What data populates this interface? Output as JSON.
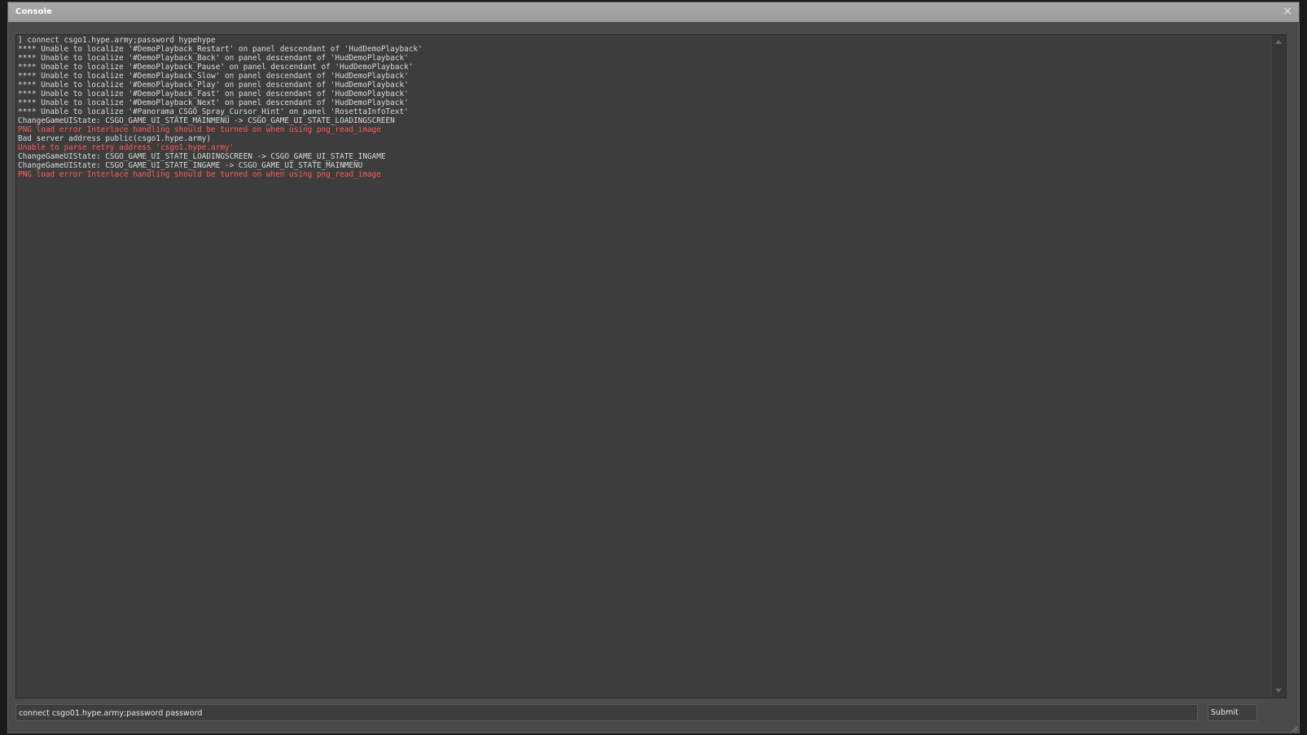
{
  "window": {
    "title": "Console",
    "close_glyph": "✕"
  },
  "console": {
    "lines": [
      {
        "text": "] connect csgo1.hype.army;password hypehype",
        "type": "normal"
      },
      {
        "text": "**** Unable to localize '#DemoPlayback_Restart' on panel descendant of 'HudDemoPlayback'",
        "type": "normal"
      },
      {
        "text": "**** Unable to localize '#DemoPlayback_Back' on panel descendant of 'HudDemoPlayback'",
        "type": "normal"
      },
      {
        "text": "**** Unable to localize '#DemoPlayback_Pause' on panel descendant of 'HudDemoPlayback'",
        "type": "normal"
      },
      {
        "text": "**** Unable to localize '#DemoPlayback_Slow' on panel descendant of 'HudDemoPlayback'",
        "type": "normal"
      },
      {
        "text": "**** Unable to localize '#DemoPlayback_Play' on panel descendant of 'HudDemoPlayback'",
        "type": "normal"
      },
      {
        "text": "**** Unable to localize '#DemoPlayback_Fast' on panel descendant of 'HudDemoPlayback'",
        "type": "normal"
      },
      {
        "text": "**** Unable to localize '#DemoPlayback_Next' on panel descendant of 'HudDemoPlayback'",
        "type": "normal"
      },
      {
        "text": "**** Unable to localize '#Panorama_CSGO_Spray_Cursor_Hint' on panel 'RosettaInfoText'",
        "type": "normal"
      },
      {
        "text": "ChangeGameUIState: CSGO_GAME_UI_STATE_MAINMENU -> CSGO_GAME_UI_STATE_LOADINGSCREEN",
        "type": "normal"
      },
      {
        "text": "PNG load error Interlace handling should be turned on when using png_read_image",
        "type": "error"
      },
      {
        "text": "Bad server address public(csgo1.hype.army)",
        "type": "normal"
      },
      {
        "text": "Unable to parse retry address 'csgo1.hype.army'",
        "type": "error"
      },
      {
        "text": "ChangeGameUIState: CSGO_GAME_UI_STATE_LOADINGSCREEN -> CSGO_GAME_UI_STATE_INGAME",
        "type": "normal"
      },
      {
        "text": "ChangeGameUIState: CSGO_GAME_UI_STATE_INGAME -> CSGO_GAME_UI_STATE_MAINMENU",
        "type": "normal"
      },
      {
        "text": "PNG load error Interlace handling should be turned on when using png_read_image",
        "type": "error"
      }
    ]
  },
  "input": {
    "value": "connect csgo01.hype.army;password password"
  },
  "submit": {
    "label": "Submit"
  },
  "colors": {
    "normal_text": "#dcdcdc",
    "error_text": "#ff5a5a",
    "background": "#3d3d3d",
    "titlebar": "#a0a0a0"
  },
  "icons": {
    "close": "close-icon",
    "scroll_up": "scroll-up-arrow-icon",
    "scroll_down": "scroll-down-arrow-icon",
    "resize": "resize-grip-icon"
  }
}
